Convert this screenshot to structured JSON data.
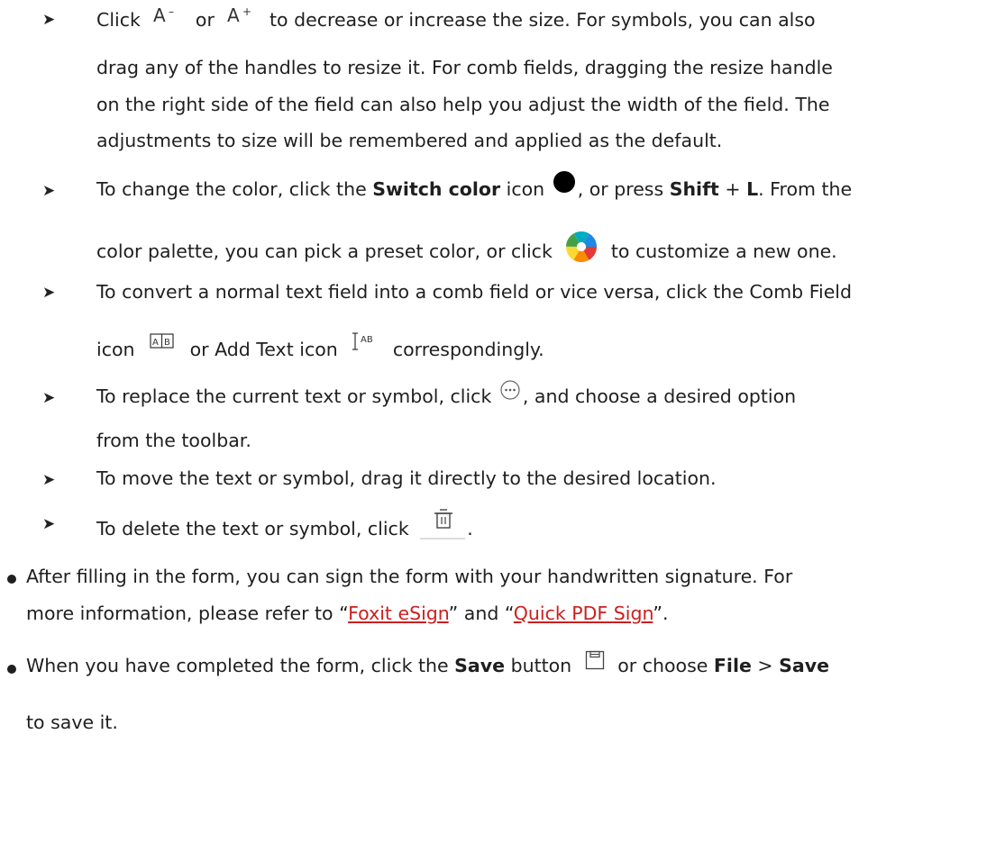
{
  "colors": {
    "text": "#1f1f1f",
    "link": "#cc1f1f"
  },
  "icons": [
    "font-decrease-icon",
    "font-increase-icon",
    "switch-color-icon",
    "color-wheel-icon",
    "comb-field-icon",
    "add-text-icon",
    "more-options-icon",
    "trash-icon",
    "save-icon"
  ],
  "b1": {
    "a": "Click",
    "b": "or",
    "c": "to decrease or increase the size. For symbols, you can also",
    "l2": "drag any of the handles to resize it. For comb fields, dragging the resize handle",
    "l3": "on the right side of the field can also help you adjust the width of the field. The",
    "l4": "adjustments to size will be remembered and applied as the default."
  },
  "b2": {
    "a": "To change the color, click the",
    "b": "Switch color",
    "c": "icon",
    "d": ", or press",
    "e": "Shift",
    "f": "+",
    "g": "L",
    "h": ". From the",
    "l2a": "color palette, you can pick a preset color, or click",
    "l2b": "to customize a new one."
  },
  "b3": {
    "l1": "To convert a normal text field into a comb field or vice versa, click the Comb Field",
    "a": "icon",
    "b": "or Add Text icon",
    "c": "correspondingly."
  },
  "b4": {
    "a": "To replace the current text or symbol, click",
    "b": ", and choose a desired option",
    "l2": "from the toolbar."
  },
  "b5": {
    "l1": "To move the text or symbol, drag it directly to the desired location."
  },
  "b6": {
    "a": "To delete the text or symbol, click",
    "b": "."
  },
  "m1": {
    "l1": "After filling in the form, you can sign the form with your handwritten signature. For",
    "a": "more information, please refer to “",
    "link1": "Foxit eSign",
    "b": "” and “",
    "link2": "Quick PDF Sign",
    "c": "”."
  },
  "m2": {
    "a": "When you have completed the form, click the",
    "b": "Save",
    "c": "button",
    "d": "or choose",
    "e": "File",
    "f": ">",
    "g": "Save",
    "l2": "to save it."
  }
}
